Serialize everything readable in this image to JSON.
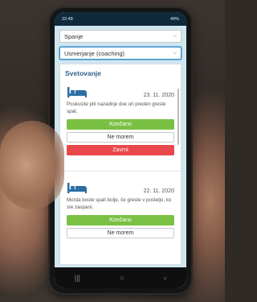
{
  "status_bar": {
    "time": "22:48",
    "right": "49%"
  },
  "form": {
    "select_sleep": {
      "value": "Spanje"
    },
    "select_mode": {
      "value": "Usmerjanje (coaching)"
    }
  },
  "panel": {
    "title": "Svetovanje"
  },
  "cards": [
    {
      "date": "23. 11. 2020",
      "text": "Poskusite piti nazadnje dve uri preden greste spat.",
      "done_label": "Končano",
      "cant_label": "Ne morem",
      "reject_label": "Zavrni"
    },
    {
      "date": "22. 11. 2020",
      "text": "Morda boste spali bolje, če greste v posteljo, ko ste zaspani.",
      "done_label": "Končano",
      "cant_label": "Ne morem"
    }
  ],
  "colors": {
    "accent": "#2d5f88",
    "done": "#7ac143",
    "reject": "#e8474c",
    "status_bar": "#0e2a3b"
  },
  "icons": [
    "bed-icon",
    "chevron-down-icon",
    "recent-apps-icon",
    "home-icon",
    "back-icon"
  ]
}
